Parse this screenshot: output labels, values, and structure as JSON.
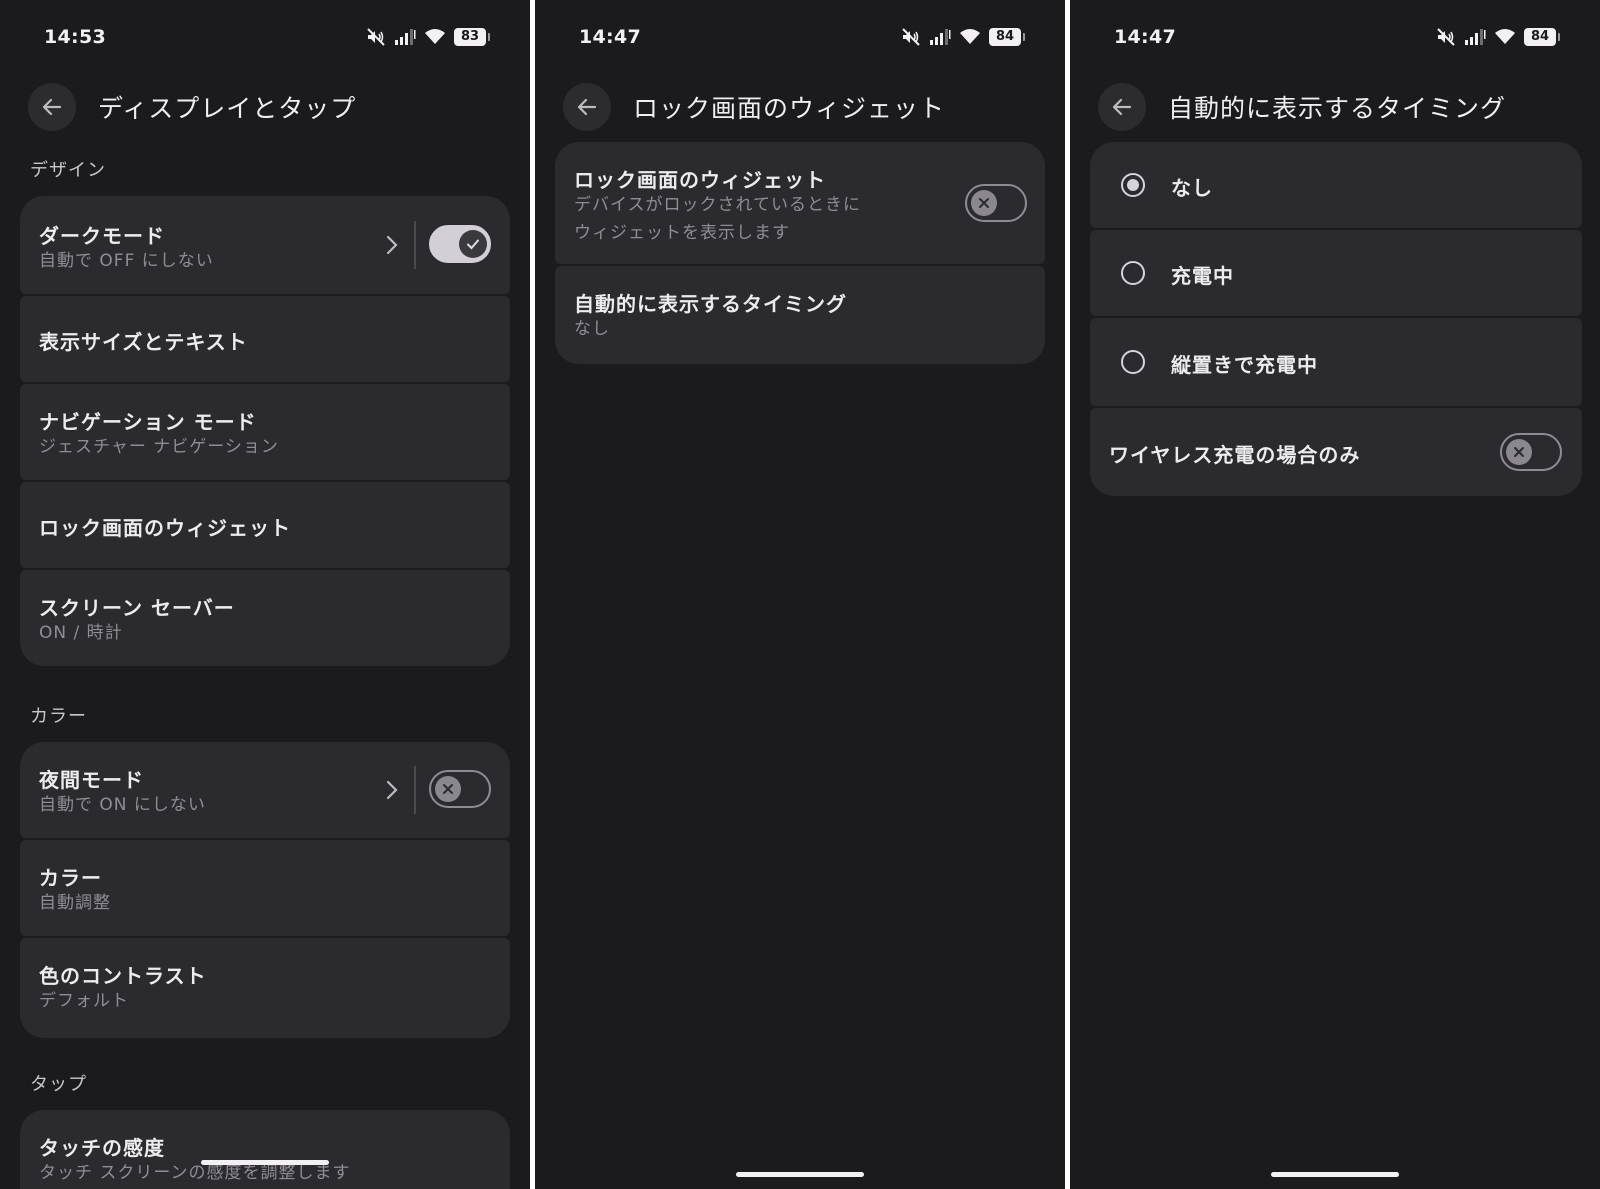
{
  "colors": {
    "background": "#1b1b1e",
    "card": "#2b2b2f",
    "text": "#ecebef",
    "subtext": "#8f8d93"
  },
  "screen1": {
    "status": {
      "time": "14:53",
      "battery": "83"
    },
    "title": "ディスプレイとタップ",
    "sections": [
      {
        "header": "デザイン",
        "items": [
          {
            "title": "ダークモード",
            "subtitle": "自動で OFF にしない",
            "toggle_on": true
          },
          {
            "title": "表示サイズとテキスト"
          },
          {
            "title": "ナビゲーション モード",
            "subtitle": "ジェスチャー ナビゲーション"
          },
          {
            "title": "ロック画面のウィジェット"
          },
          {
            "title": "スクリーン セーバー",
            "subtitle": "ON / 時計"
          }
        ]
      },
      {
        "header": "カラー",
        "items": [
          {
            "title": "夜間モード",
            "subtitle": "自動で ON にしない",
            "toggle_on": false
          },
          {
            "title": "カラー",
            "subtitle": "自動調整"
          },
          {
            "title": "色のコントラスト",
            "subtitle": "デフォルト"
          }
        ]
      },
      {
        "header": "タップ",
        "items": [
          {
            "title": "タッチの感度",
            "subtitle": "タッチ スクリーンの感度を調整します"
          }
        ]
      }
    ]
  },
  "screen2": {
    "status": {
      "time": "14:47",
      "battery": "84"
    },
    "title": "ロック画面のウィジェット",
    "items": [
      {
        "title": "ロック画面のウィジェット",
        "subtitle_line1": "デバイスがロックされているときに",
        "subtitle_line2": "ウィジェットを表示します",
        "toggle_on": false
      },
      {
        "title": "自動的に表示するタイミング",
        "subtitle": "なし"
      }
    ]
  },
  "screen3": {
    "status": {
      "time": "14:47",
      "battery": "84"
    },
    "title": "自動的に表示するタイミング",
    "options": [
      {
        "label": "なし",
        "selected": true
      },
      {
        "label": "充電中",
        "selected": false
      },
      {
        "label": "縦置きで充電中",
        "selected": false
      }
    ],
    "wireless": {
      "label": "ワイヤレス充電の場合のみ",
      "toggle_on": false
    }
  }
}
